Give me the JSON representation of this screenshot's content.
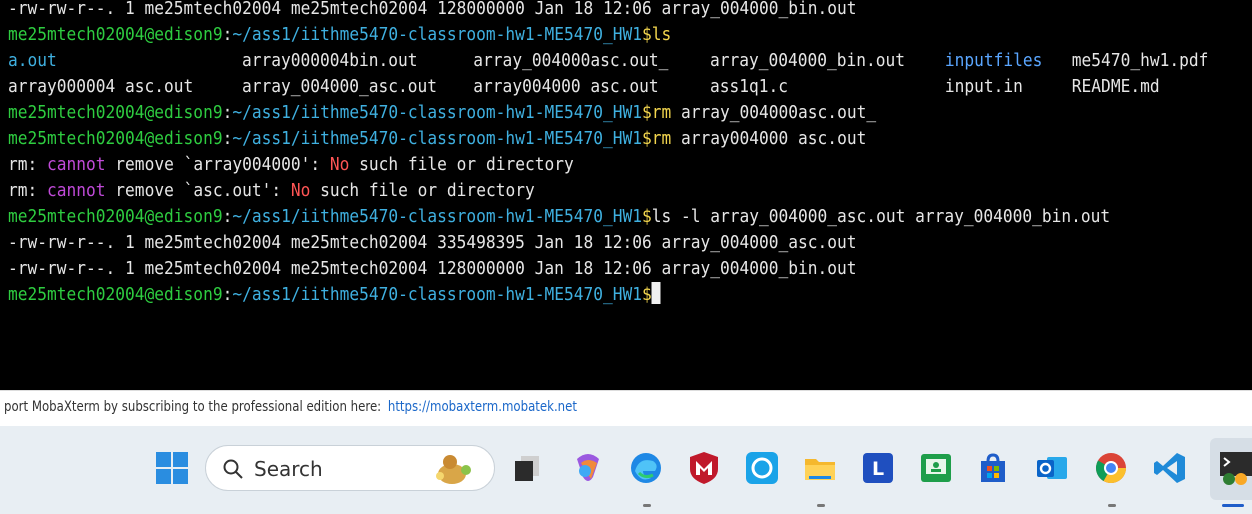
{
  "terminal": {
    "top_partial_line": "-rw-rw-r--. 1 me25mtech02004 me25mtech02004 128000000 Jan 18 12:06 array_004000_bin.out",
    "prompt": {
      "user_host": "me25mtech02004@edison9",
      "sep": ":",
      "path": "~/ass1/iithme5470-classroom-hw1-ME5470_HW1",
      "dollar": "$"
    },
    "cmd1": "ls",
    "ls_row1": [
      "a.out",
      "array000004bin.out",
      "array_004000asc.out_",
      "array_004000_bin.out",
      "inputfiles",
      "me5470_hw1.pdf"
    ],
    "ls_row2": [
      "array000004 asc.out",
      "array_004000_asc.out",
      "array004000 asc.out",
      "ass1q1.c",
      "input.in",
      "README.md"
    ],
    "cmd2_verb": "rm",
    "cmd2_args": " array_004000asc.out_",
    "cmd3_verb": "rm",
    "cmd3_args": " array004000 asc.out",
    "err1": {
      "a": "rm: ",
      "b": "cannot",
      "c": " remove `array004000': ",
      "d": "No",
      "e": " such file or directory"
    },
    "err2": {
      "a": "rm: ",
      "b": "cannot",
      "c": " remove `asc.out': ",
      "d": "No",
      "e": " such file or directory"
    },
    "cmd4": "ls -l array_004000_asc.out array_004000_bin.out",
    "out1": "-rw-rw-r--. 1 me25mtech02004 me25mtech02004 335498395 Jan 18 12:06 array_004000_asc.out",
    "out2": "-rw-rw-r--. 1 me25mtech02004 me25mtech02004 128000000 Jan 18 12:06 array_004000_bin.out"
  },
  "banner": {
    "text": "port MobaXterm by subscribing to the professional edition here:",
    "link": "https://mobaxterm.mobatek.net"
  },
  "taskbar": {
    "search_placeholder": "Search",
    "icons": [
      "windows-start-icon",
      "task-view-icon",
      "copilot-icon",
      "edge-icon",
      "mcafee-icon",
      "alexa-icon",
      "file-explorer-icon",
      "launcher-l-icon",
      "classroom-icon",
      "microsoft-store-icon",
      "outlook-icon",
      "chrome-icon",
      "vscode-icon",
      "mobaxterm-icon"
    ]
  }
}
